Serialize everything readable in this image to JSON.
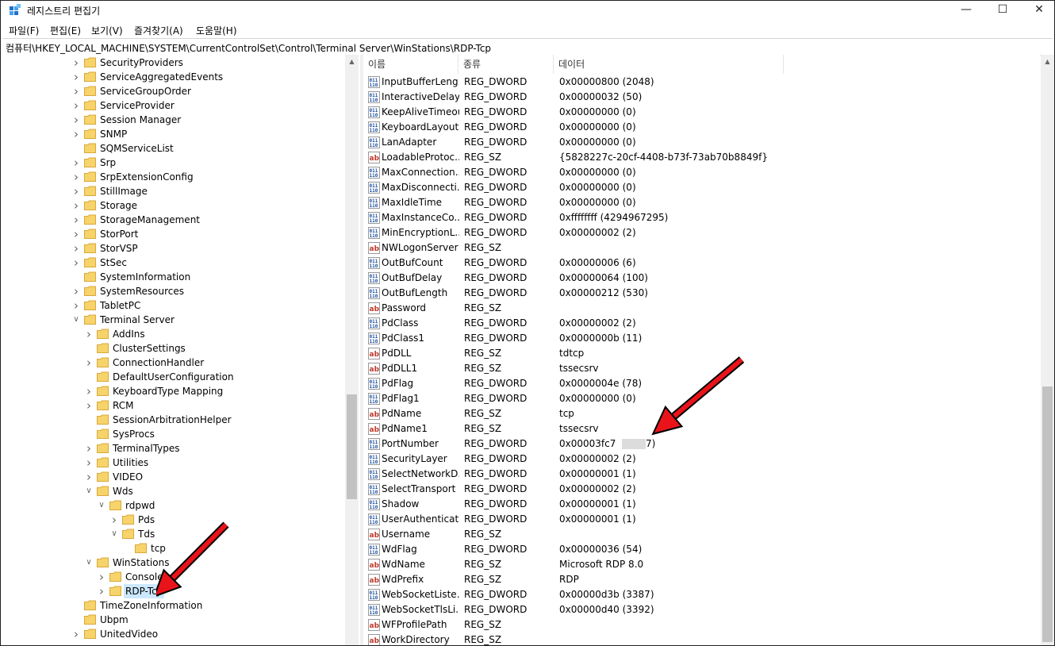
{
  "window": {
    "title": "레지스트리 편집기",
    "minimize": "—",
    "maximize": "☐",
    "close": "✕"
  },
  "menu": [
    "파일(F)",
    "편집(E)",
    "보기(V)",
    "즐겨찾기(A)",
    "도움말(H)"
  ],
  "address": "컴퓨터\\HKEY_LOCAL_MACHINE\\SYSTEM\\CurrentControlSet\\Control\\Terminal Server\\WinStations\\RDP-Tcp",
  "tree": [
    {
      "label": "SecurityProviders",
      "expander": "collapsed",
      "depth": 0
    },
    {
      "label": "ServiceAggregatedEvents",
      "expander": "collapsed",
      "depth": 0
    },
    {
      "label": "ServiceGroupOrder",
      "expander": "collapsed",
      "depth": 0
    },
    {
      "label": "ServiceProvider",
      "expander": "collapsed",
      "depth": 0
    },
    {
      "label": "Session Manager",
      "expander": "collapsed",
      "depth": 0
    },
    {
      "label": "SNMP",
      "expander": "collapsed",
      "depth": 0
    },
    {
      "label": "SQMServiceList",
      "expander": "none",
      "depth": 0
    },
    {
      "label": "Srp",
      "expander": "collapsed",
      "depth": 0
    },
    {
      "label": "SrpExtensionConfig",
      "expander": "collapsed",
      "depth": 0
    },
    {
      "label": "StillImage",
      "expander": "collapsed",
      "depth": 0
    },
    {
      "label": "Storage",
      "expander": "collapsed",
      "depth": 0
    },
    {
      "label": "StorageManagement",
      "expander": "collapsed",
      "depth": 0
    },
    {
      "label": "StorPort",
      "expander": "collapsed",
      "depth": 0
    },
    {
      "label": "StorVSP",
      "expander": "collapsed",
      "depth": 0
    },
    {
      "label": "StSec",
      "expander": "collapsed",
      "depth": 0
    },
    {
      "label": "SystemInformation",
      "expander": "none",
      "depth": 0
    },
    {
      "label": "SystemResources",
      "expander": "collapsed",
      "depth": 0
    },
    {
      "label": "TabletPC",
      "expander": "collapsed",
      "depth": 0
    },
    {
      "label": "Terminal Server",
      "expander": "expanded",
      "depth": 0
    },
    {
      "label": "AddIns",
      "expander": "collapsed",
      "depth": 1
    },
    {
      "label": "ClusterSettings",
      "expander": "none",
      "depth": 1
    },
    {
      "label": "ConnectionHandler",
      "expander": "collapsed",
      "depth": 1
    },
    {
      "label": "DefaultUserConfiguration",
      "expander": "none",
      "depth": 1
    },
    {
      "label": "KeyboardType Mapping",
      "expander": "collapsed",
      "depth": 1
    },
    {
      "label": "RCM",
      "expander": "collapsed",
      "depth": 1
    },
    {
      "label": "SessionArbitrationHelper",
      "expander": "none",
      "depth": 1
    },
    {
      "label": "SysProcs",
      "expander": "none",
      "depth": 1
    },
    {
      "label": "TerminalTypes",
      "expander": "collapsed",
      "depth": 1
    },
    {
      "label": "Utilities",
      "expander": "collapsed",
      "depth": 1
    },
    {
      "label": "VIDEO",
      "expander": "collapsed",
      "depth": 1
    },
    {
      "label": "Wds",
      "expander": "expanded",
      "depth": 1
    },
    {
      "label": "rdpwd",
      "expander": "expanded",
      "depth": 2
    },
    {
      "label": "Pds",
      "expander": "collapsed",
      "depth": 3
    },
    {
      "label": "Tds",
      "expander": "expanded",
      "depth": 3
    },
    {
      "label": "tcp",
      "expander": "none",
      "depth": 4
    },
    {
      "label": "WinStations",
      "expander": "expanded",
      "depth": 1
    },
    {
      "label": "Console",
      "expander": "collapsed",
      "depth": 2
    },
    {
      "label": "RDP-Tcp",
      "expander": "collapsed",
      "depth": 2,
      "selected": true
    },
    {
      "label": "TimeZoneInformation",
      "expander": "none",
      "depth": 0
    },
    {
      "label": "Ubpm",
      "expander": "none",
      "depth": 0
    },
    {
      "label": "UnitedVideo",
      "expander": "collapsed",
      "depth": 0
    }
  ],
  "columns": {
    "name": "이름",
    "type": "종류",
    "data": "데이터"
  },
  "values": [
    {
      "name": "InputBufferLeng...",
      "type": "REG_DWORD",
      "data": "0x00000800 (2048)",
      "icon": "dword"
    },
    {
      "name": "InteractiveDelay",
      "type": "REG_DWORD",
      "data": "0x00000032 (50)",
      "icon": "dword"
    },
    {
      "name": "KeepAliveTimeout",
      "type": "REG_DWORD",
      "data": "0x00000000 (0)",
      "icon": "dword"
    },
    {
      "name": "KeyboardLayout",
      "type": "REG_DWORD",
      "data": "0x00000000 (0)",
      "icon": "dword"
    },
    {
      "name": "LanAdapter",
      "type": "REG_DWORD",
      "data": "0x00000000 (0)",
      "icon": "dword"
    },
    {
      "name": "LoadableProtoc...",
      "type": "REG_SZ",
      "data": "{5828227c-20cf-4408-b73f-73ab70b8849f}",
      "icon": "sz"
    },
    {
      "name": "MaxConnection...",
      "type": "REG_DWORD",
      "data": "0x00000000 (0)",
      "icon": "dword"
    },
    {
      "name": "MaxDisconnecti...",
      "type": "REG_DWORD",
      "data": "0x00000000 (0)",
      "icon": "dword"
    },
    {
      "name": "MaxIdleTime",
      "type": "REG_DWORD",
      "data": "0x00000000 (0)",
      "icon": "dword"
    },
    {
      "name": "MaxInstanceCo...",
      "type": "REG_DWORD",
      "data": "0xffffffff (4294967295)",
      "icon": "dword"
    },
    {
      "name": "MinEncryptionL...",
      "type": "REG_DWORD",
      "data": "0x00000002 (2)",
      "icon": "dword"
    },
    {
      "name": "NWLogonServer",
      "type": "REG_SZ",
      "data": "",
      "icon": "sz"
    },
    {
      "name": "OutBufCount",
      "type": "REG_DWORD",
      "data": "0x00000006 (6)",
      "icon": "dword"
    },
    {
      "name": "OutBufDelay",
      "type": "REG_DWORD",
      "data": "0x00000064 (100)",
      "icon": "dword"
    },
    {
      "name": "OutBufLength",
      "type": "REG_DWORD",
      "data": "0x00000212 (530)",
      "icon": "dword"
    },
    {
      "name": "Password",
      "type": "REG_SZ",
      "data": "",
      "icon": "sz"
    },
    {
      "name": "PdClass",
      "type": "REG_DWORD",
      "data": "0x00000002 (2)",
      "icon": "dword"
    },
    {
      "name": "PdClass1",
      "type": "REG_DWORD",
      "data": "0x0000000b (11)",
      "icon": "dword"
    },
    {
      "name": "PdDLL",
      "type": "REG_SZ",
      "data": "tdtcp",
      "icon": "sz"
    },
    {
      "name": "PdDLL1",
      "type": "REG_SZ",
      "data": "tssecsrv",
      "icon": "sz"
    },
    {
      "name": "PdFlag",
      "type": "REG_DWORD",
      "data": "0x0000004e (78)",
      "icon": "dword"
    },
    {
      "name": "PdFlag1",
      "type": "REG_DWORD",
      "data": "0x00000000 (0)",
      "icon": "dword"
    },
    {
      "name": "PdName",
      "type": "REG_SZ",
      "data": "tcp",
      "icon": "sz"
    },
    {
      "name": "PdName1",
      "type": "REG_SZ",
      "data": "tssecsrv",
      "icon": "sz"
    },
    {
      "name": "PortNumber",
      "type": "REG_DWORD",
      "data": "0x00003fc7",
      "data_tail": "7)",
      "blurred": true,
      "icon": "dword"
    },
    {
      "name": "SecurityLayer",
      "type": "REG_DWORD",
      "data": "0x00000002 (2)",
      "icon": "dword"
    },
    {
      "name": "SelectNetworkD...",
      "type": "REG_DWORD",
      "data": "0x00000001 (1)",
      "icon": "dword"
    },
    {
      "name": "SelectTransport",
      "type": "REG_DWORD",
      "data": "0x00000002 (2)",
      "icon": "dword"
    },
    {
      "name": "Shadow",
      "type": "REG_DWORD",
      "data": "0x00000001 (1)",
      "icon": "dword"
    },
    {
      "name": "UserAuthenticat...",
      "type": "REG_DWORD",
      "data": "0x00000001 (1)",
      "icon": "dword"
    },
    {
      "name": "Username",
      "type": "REG_SZ",
      "data": "",
      "icon": "sz"
    },
    {
      "name": "WdFlag",
      "type": "REG_DWORD",
      "data": "0x00000036 (54)",
      "icon": "dword"
    },
    {
      "name": "WdName",
      "type": "REG_SZ",
      "data": "Microsoft RDP 8.0",
      "icon": "sz"
    },
    {
      "name": "WdPrefix",
      "type": "REG_SZ",
      "data": "RDP",
      "icon": "sz"
    },
    {
      "name": "WebSocketListe...",
      "type": "REG_DWORD",
      "data": "0x00000d3b (3387)",
      "icon": "dword"
    },
    {
      "name": "WebSocketTlsLi...",
      "type": "REG_DWORD",
      "data": "0x00000d40 (3392)",
      "icon": "dword"
    },
    {
      "name": "WFProfilePath",
      "type": "REG_SZ",
      "data": "",
      "icon": "sz"
    },
    {
      "name": "WorkDirectory",
      "type": "REG_SZ",
      "data": "",
      "icon": "sz"
    }
  ],
  "colors": {
    "folder": "#f7d36b",
    "folder_edge": "#d9a93a",
    "selection": "#cce8ff",
    "arrow": "#e8141a"
  }
}
